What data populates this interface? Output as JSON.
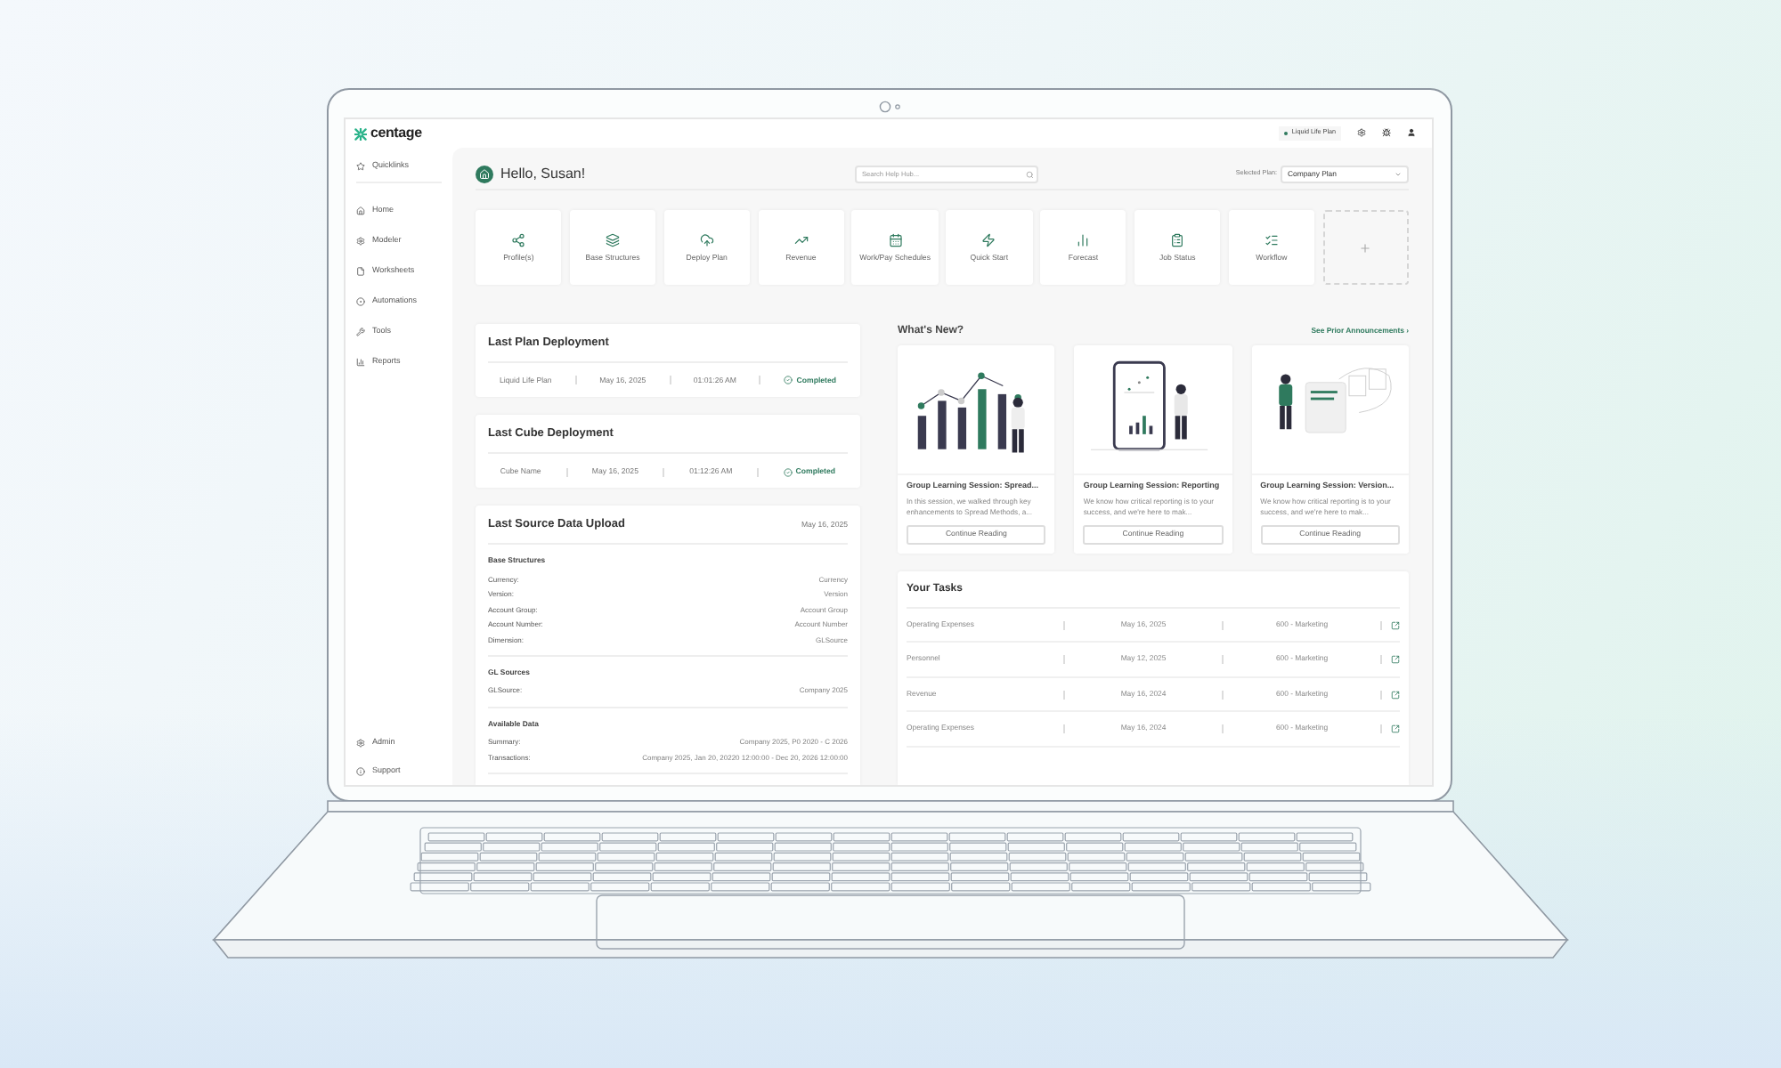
{
  "logo": "centage",
  "top_bar": {
    "plan": "Liquid Life Plan"
  },
  "sidebar": {
    "items": [
      {
        "label": "Quicklinks",
        "kind": "quicklinks"
      },
      {
        "label": "Home",
        "kind": "home"
      },
      {
        "label": "Modeler",
        "kind": "modeler"
      },
      {
        "label": "Worksheets",
        "kind": "worksheets"
      },
      {
        "label": "Automations",
        "kind": "automations"
      },
      {
        "label": "Tools",
        "kind": "tools"
      },
      {
        "label": "Reports",
        "kind": "reports"
      }
    ],
    "bottom": [
      {
        "label": "Admin",
        "kind": "admin"
      },
      {
        "label": "Support",
        "kind": "support"
      }
    ]
  },
  "header": {
    "greeting": "Hello, Susan!",
    "search": {
      "placeholder": "Search Help Hub..."
    },
    "selected_plan": {
      "label": "Selected Plan:",
      "value": "Company Plan"
    }
  },
  "quicklinks": [
    {
      "label": "Profile(s)",
      "kind": "profiles"
    },
    {
      "label": "Base Structures",
      "kind": "structures"
    },
    {
      "label": "Deploy Plan",
      "kind": "deploy"
    },
    {
      "label": "Revenue",
      "kind": "revenue"
    },
    {
      "label": "Work/Pay Schedules",
      "kind": "schedules"
    },
    {
      "label": "Quick Start",
      "kind": "quickstart"
    },
    {
      "label": "Forecast",
      "kind": "forecast"
    },
    {
      "label": "Job Status",
      "kind": "jobstatus"
    },
    {
      "label": "Workflow",
      "kind": "workflow"
    },
    {
      "kind": "add"
    }
  ],
  "deployments": [
    {
      "title": "Last Plan Deployment",
      "name": "Liquid Life Plan",
      "date": "May 16, 2025",
      "time": "01:01:26 AM",
      "status": "Completed"
    },
    {
      "title": "Last Cube Deployment",
      "name": "Cube Name",
      "date": "May 16, 2025",
      "time": "01:12:26 AM",
      "status": "Completed"
    }
  ],
  "source_upload": {
    "title": "Last Source Data Upload",
    "date": "May 16, 2025",
    "sections": [
      {
        "heading": "Base Structures",
        "rows": [
          {
            "label": "Currency:",
            "value": "Currency"
          },
          {
            "label": "Version:",
            "value": "Version"
          },
          {
            "label": "Account Group:",
            "value": "Account Group"
          },
          {
            "label": "Account Number:",
            "value": "Account Number"
          },
          {
            "label": "Dimension:",
            "value": "GLSource"
          }
        ]
      },
      {
        "heading": "GL Sources",
        "rows": [
          {
            "label": "GLSource:",
            "value": "Company 2025"
          }
        ]
      },
      {
        "heading": "Available Data",
        "rows": [
          {
            "label": "Summary:",
            "value": "Company 2025, P0 2020 - C 2026"
          },
          {
            "label": "Transactions:",
            "value": "Company 2025, Jan 20, 20220 12:00:00 - Dec 20, 2026 12:00:00"
          }
        ]
      }
    ]
  },
  "whats_new": {
    "title": "What's New?",
    "link": "See Prior Announcements ›",
    "cards": [
      {
        "kind": "chart",
        "title": "Group Learning Session: Spread...",
        "excerpt": "In this session, we walked through key enhancements to Spread Methods, a...",
        "button": "Continue Reading"
      },
      {
        "kind": "tablet",
        "title": "Group Learning Session: Reporting",
        "excerpt": "We know how critical reporting is to your success, and we're here to mak...",
        "button": "Continue Reading"
      },
      {
        "kind": "documents",
        "title": "Group Learning Session: Version...",
        "excerpt": "We know how critical reporting is to your success, and we're here to mak...",
        "button": "Continue Reading"
      }
    ]
  },
  "tasks": {
    "title": "Your Tasks",
    "rows": [
      {
        "name": "Operating Expenses",
        "date": "May 16, 2025",
        "department": "600 - Marketing"
      },
      {
        "name": "Personnel",
        "date": "May 12, 2025",
        "department": "600 - Marketing"
      },
      {
        "name": "Revenue",
        "date": "May 16, 2024",
        "department": "600 - Marketing"
      },
      {
        "name": "Operating Expenses",
        "date": "May 16, 2024",
        "department": "600 - Marketing"
      }
    ]
  }
}
